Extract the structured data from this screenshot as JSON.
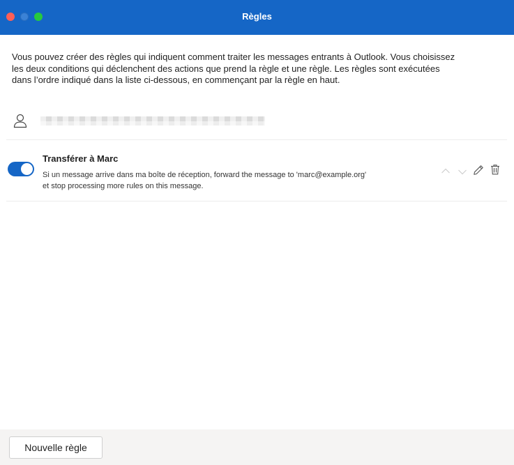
{
  "window": {
    "title": "Règles",
    "accent_color": "#1566c6"
  },
  "intro_text": "Vous pouvez créer des règles qui indiquent comment traiter les messages entrants à Outlook. Vous choisissez les deux conditions qui déclenchent des actions que prend la règle et une règle. Les règles sont exécutées dans l’ordre indiqué dans la liste ci-dessous, en commençant par la règle en haut.",
  "account": {
    "icon": "person-icon",
    "email_redacted": true
  },
  "rules": [
    {
      "name": "Transférer à Marc",
      "enabled": true,
      "description_line1": "Si un message arrive dans ma boîte de réception, forward the message to 'marc@example.org'",
      "description_line2": "et stop processing more rules on this message."
    }
  ],
  "footer": {
    "new_rule_label": "Nouvelle règle"
  }
}
